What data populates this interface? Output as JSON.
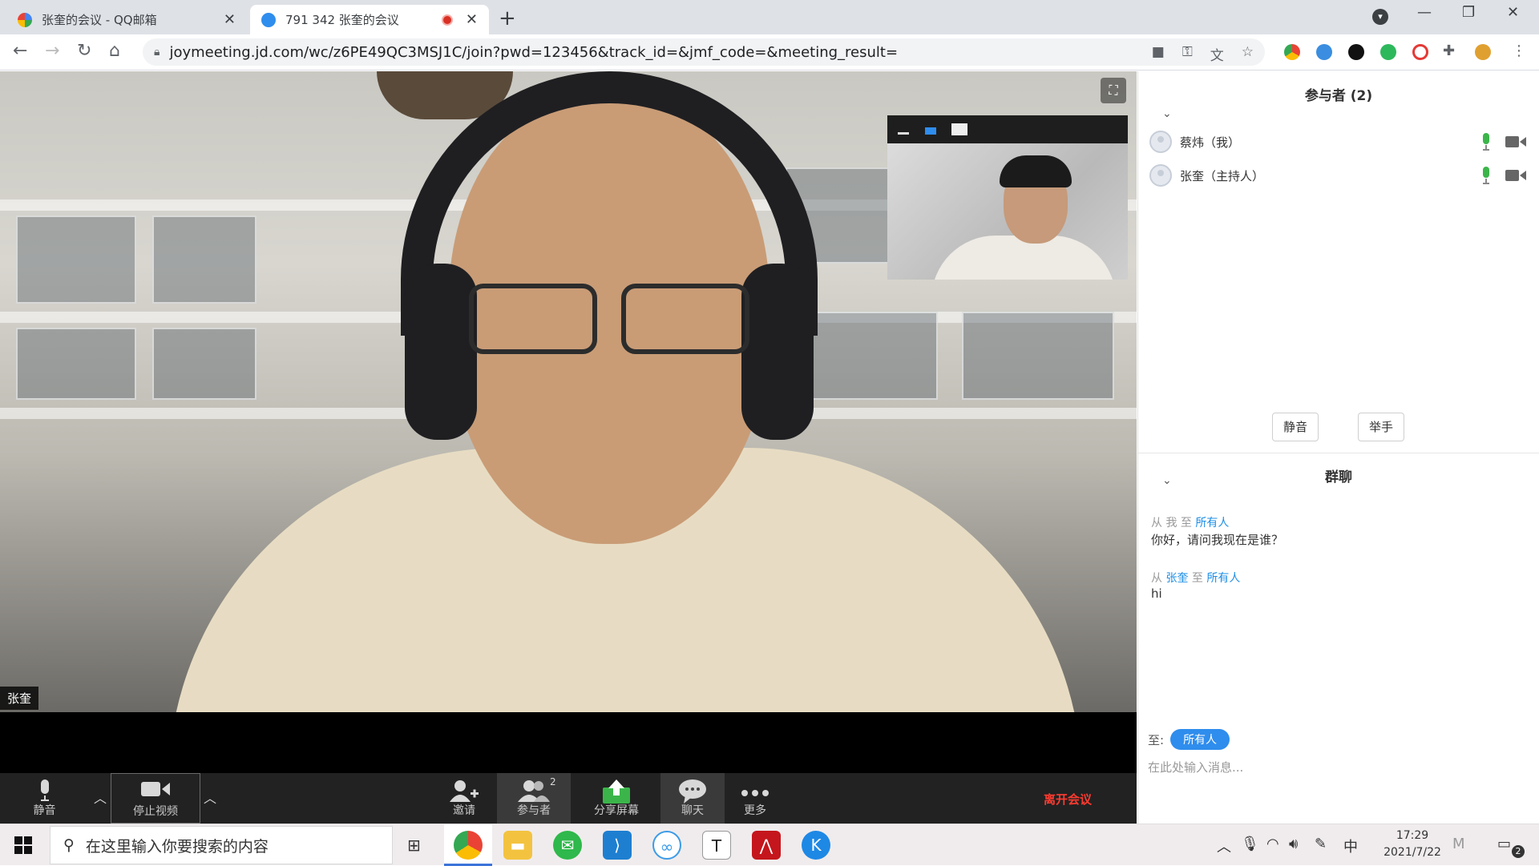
{
  "browser": {
    "tabs": [
      {
        "title": "张奎的会议 - QQ邮箱",
        "close": "✕"
      },
      {
        "title": "791 342 张奎的会议",
        "close": "✕"
      }
    ],
    "new_tab": "+",
    "window": {
      "minimize": "—",
      "restore": "❐",
      "close": "✕"
    },
    "url": "joymeeting.jd.com/wc/z6PE49QC3MSJ1C/join?pwd=123456&track_id=&jmf_code=&meeting_result="
  },
  "meeting": {
    "active_speaker_name": "张奎"
  },
  "controls": {
    "mute": "静音",
    "stop_video": "停止视频",
    "invite": "邀请",
    "participants": "参与者",
    "participants_count": "2",
    "share_screen": "分享屏幕",
    "chat": "聊天",
    "more": "更多",
    "leave": "离开会议"
  },
  "participants_panel": {
    "title": "参与者 (2)",
    "items": [
      {
        "name": "蔡炜（我）"
      },
      {
        "name": "张奎（主持人）"
      }
    ],
    "mute_button": "静音",
    "raise_hand_button": "举手"
  },
  "chat_panel": {
    "title": "群聊",
    "messages": [
      {
        "from_prefix": "从",
        "from": "我",
        "to_prefix": "至",
        "to": "所有人",
        "text": "你好，请问我现在是谁？"
      },
      {
        "from_prefix": "从",
        "from": "张奎",
        "to_prefix": "至",
        "to": "所有人",
        "text": "hi"
      }
    ],
    "to_label": "至:",
    "to_value": "所有人",
    "input_placeholder": "在此处输入消息..."
  },
  "taskbar": {
    "search_placeholder": "在这里输入你要搜索的内容",
    "ime": "中",
    "time": "17:29",
    "date": "2021/7/22",
    "notification_count": "2"
  },
  "colors": {
    "accent": "#2f8ded",
    "leave": "#ff3b30",
    "toolbar_bg": "#222222"
  }
}
